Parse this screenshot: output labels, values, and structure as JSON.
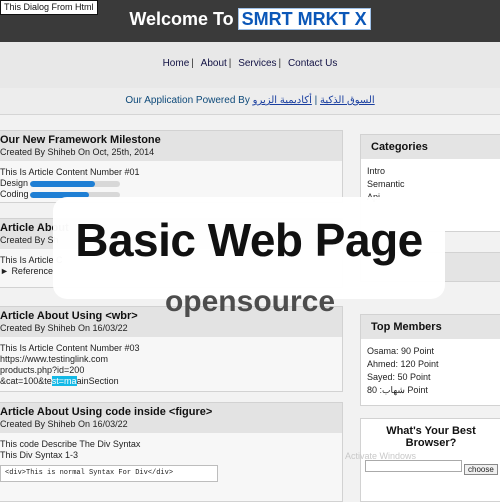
{
  "header": {
    "dialog_label": "This Dialog From Html",
    "title_prefix": "Welcome To",
    "brand": "SMRT MRKT X"
  },
  "nav": [
    {
      "label": "Home",
      "sep": "|"
    },
    {
      "label": "About",
      "sep": "|"
    },
    {
      "label": "Services",
      "sep": "|"
    },
    {
      "label": "Contact Us",
      "sep": ""
    }
  ],
  "powered": {
    "text": "Our Application Powered By",
    "link1": "السوق الذكية",
    "sep": "|",
    "link2": "أكاديمية الزيرو"
  },
  "articles": [
    {
      "title": "Our New Framework Milestone",
      "by": "Created By Shiheb On Oct, 25th, 2014",
      "content": "This Is Article Content Number #01",
      "bars": [
        {
          "label": "Design",
          "value": 0.72
        },
        {
          "label": "Coding",
          "value": 0.66
        }
      ]
    },
    {
      "title": "Article About",
      "by": "Created By Sh",
      "content": "This Is Article C",
      "details": "Reference"
    },
    {
      "title": "Article About Using <wbr>",
      "by": "Created By Shiheb On 16/03/22",
      "line1": "This Is Article Content Number #03",
      "line2": "https://www.testinglink.com",
      "line3": "products.php?id=200",
      "line4_pre": "&cat=100&te",
      "line4_hl": "st=ma",
      "line4_post": "ainSection"
    },
    {
      "title": "Article About Using code inside <figure>",
      "by": "Created By Shiheb On 16/03/22",
      "line1": "This code Describe The Div Syntax",
      "line2": "This Div Syntax 1-3",
      "code": "<div>This is normal Syntax For Div</div>"
    }
  ],
  "sidebar": {
    "categories_title": "Categories",
    "categories": [
      "Intro",
      "Semantic",
      "Api"
    ],
    "members_title": "Top Members",
    "members": [
      "Osama: 90 Point",
      "Ahmed: 120 Point",
      "Sayed: 50 Point",
      "شهاب: 80 Point"
    ],
    "poll_title": "What's Your Best Browser?",
    "poll_button": "choose"
  },
  "overlay": {
    "title": "Basic Web Page",
    "subtitle": "opensource"
  },
  "watermark": "Activate Windows"
}
